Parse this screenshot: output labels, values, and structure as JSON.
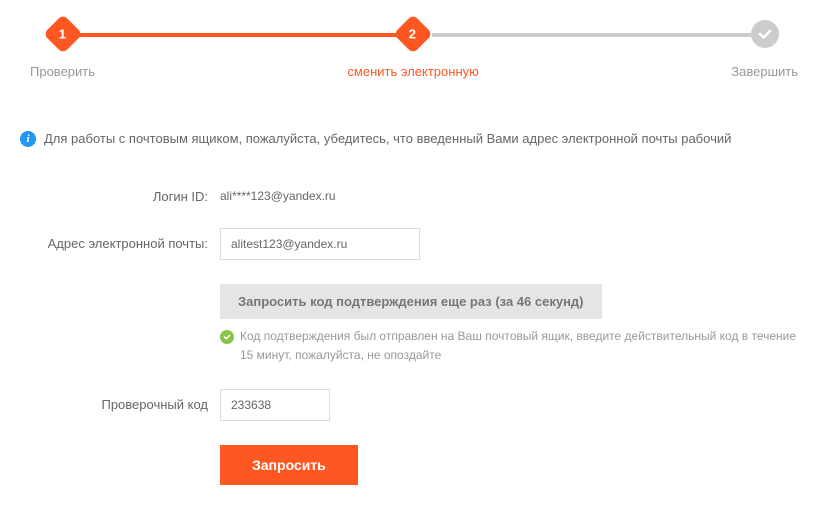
{
  "steps": {
    "step1_number": "1",
    "step1_label": "Проверить",
    "step2_number": "2",
    "step2_label": "сменить электронную",
    "step3_label": "Завершить"
  },
  "info": {
    "text": "Для работы с почтовым ящиком, пожалуйста, убедитесь, что введенный Вами адрес электронной почты рабочий"
  },
  "form": {
    "login_label": "Логин ID:",
    "login_value": "ali****123@yandex.ru",
    "email_label": "Адрес электронной почты:",
    "email_value": "alitest123@yandex.ru",
    "resend_label": "Запросить код подтверждения еще раз (за 46 секунд)",
    "sent_text": "Код подтверждения был отправлен на Ваш почтовый ящик, введите действительный код в течение 15 минут, пожалуйста, не опоздайте",
    "code_label": "Проверочный код",
    "code_value": "233638",
    "submit_label": "Запросить"
  }
}
